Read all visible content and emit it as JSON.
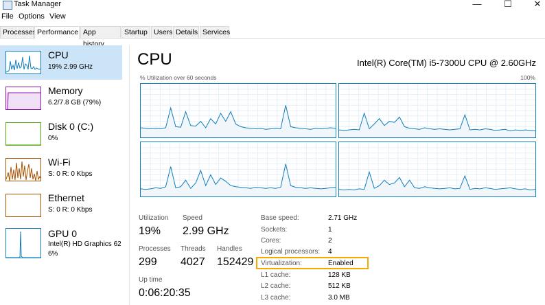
{
  "window": {
    "title": "Task Manager",
    "minimize_glyph": "—",
    "maximize_glyph": "☐",
    "close_glyph": "✕"
  },
  "menu": [
    "File",
    "Options",
    "View"
  ],
  "tabs": [
    "Processes",
    "Performance",
    "App history",
    "Startup",
    "Users",
    "Details",
    "Services"
  ],
  "active_tab": "Performance",
  "sidebar": [
    {
      "name": "CPU",
      "sub1": "19% 2.99 GHz"
    },
    {
      "name": "Memory",
      "sub1": "6.2/7.8 GB (79%)"
    },
    {
      "name": "Disk 0 (C:)",
      "sub1": "0%"
    },
    {
      "name": "Wi-Fi",
      "sub1": "S: 0 R: 0 Kbps"
    },
    {
      "name": "Ethernet",
      "sub1": "S: 0 R: 0 Kbps"
    },
    {
      "name": "GPU 0",
      "sub1": "Intel(R) HD Graphics 62",
      "sub2": "6%"
    }
  ],
  "colors": {
    "cpu": "#117dbb",
    "memory": "#8b12ae",
    "disk": "#4da60c",
    "network": "#a74f01",
    "selected": "#cce4f7",
    "highlight": "#f2a900"
  },
  "main": {
    "title": "CPU",
    "model": "Intel(R) Core(TM) i5-7300U CPU @ 2.60GHz",
    "graph_caption": "% Utilization over 60 seconds",
    "graph_max": "100%",
    "core_graphs": [
      [
        18,
        17,
        16,
        17,
        16,
        18,
        55,
        20,
        19,
        48,
        22,
        21,
        30,
        18,
        35,
        25,
        45,
        30,
        48,
        25,
        20,
        18,
        17,
        16,
        17,
        15,
        16,
        17,
        16,
        60,
        20,
        18,
        17,
        16,
        15,
        17,
        16,
        17,
        18,
        17
      ],
      [
        14,
        13,
        14,
        15,
        14,
        45,
        16,
        25,
        35,
        22,
        30,
        28,
        38,
        20,
        17,
        16,
        15,
        18,
        16,
        15,
        16,
        15,
        14,
        15,
        16,
        42,
        14,
        15,
        14,
        16,
        15,
        13,
        14,
        15,
        12,
        14,
        13,
        14,
        13,
        12
      ],
      [
        14,
        13,
        14,
        16,
        15,
        18,
        55,
        16,
        18,
        30,
        15,
        25,
        48,
        20,
        40,
        22,
        34,
        28,
        20,
        18,
        17,
        16,
        15,
        17,
        16,
        15,
        16,
        15,
        17,
        60,
        20,
        17,
        16,
        15,
        16,
        15,
        14,
        15,
        16,
        17
      ],
      [
        13,
        12,
        13,
        12,
        14,
        13,
        45,
        15,
        20,
        30,
        22,
        25,
        35,
        18,
        30,
        16,
        15,
        18,
        16,
        15,
        14,
        15,
        16,
        14,
        15,
        38,
        13,
        15,
        14,
        16,
        15,
        13,
        14,
        15,
        16,
        14,
        13,
        14,
        12,
        13
      ]
    ],
    "stats": {
      "utilization_label": "Utilization",
      "utilization": "19%",
      "speed_label": "Speed",
      "speed": "2.99 GHz",
      "processes_label": "Processes",
      "processes": "299",
      "threads_label": "Threads",
      "threads": "4027",
      "handles_label": "Handles",
      "handles": "152429",
      "uptime_label": "Up time",
      "uptime": "0:06:20:35"
    },
    "details": [
      {
        "label": "Base speed:",
        "value": "2.71 GHz"
      },
      {
        "label": "Sockets:",
        "value": "1"
      },
      {
        "label": "Cores:",
        "value": "2"
      },
      {
        "label": "Logical processors:",
        "value": "4"
      },
      {
        "label": "Virtualization:",
        "value": "Enabled"
      },
      {
        "label": "L1 cache:",
        "value": "128 KB"
      },
      {
        "label": "L2 cache:",
        "value": "512 KB"
      },
      {
        "label": "L3 cache:",
        "value": "3.0 MB"
      }
    ]
  }
}
